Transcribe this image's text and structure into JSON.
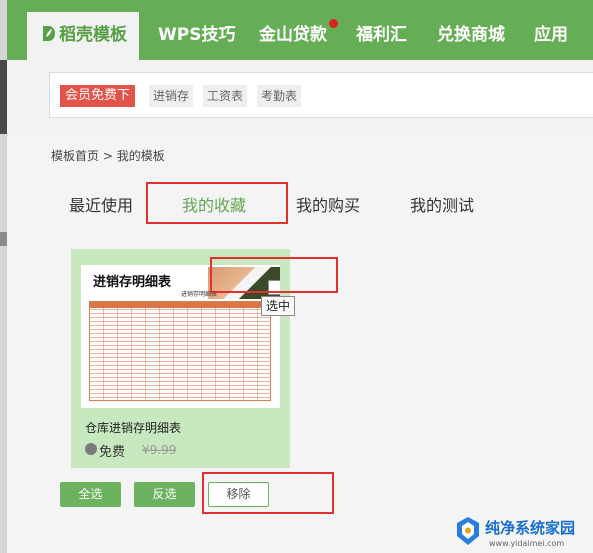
{
  "nav": {
    "tabs": [
      {
        "label": "稻壳模板"
      },
      {
        "label": "WPS技巧"
      },
      {
        "label": "金山贷款"
      },
      {
        "label": "福利汇"
      },
      {
        "label": "兑换商城"
      },
      {
        "label": "应用"
      }
    ],
    "brand_color": "#65ae55"
  },
  "tags": {
    "vip_label": "会员免费下",
    "items": [
      "进销存",
      "工资表",
      "考勤表"
    ]
  },
  "breadcrumb": {
    "home": "模板首页",
    "separator": ">",
    "current": "我的模板"
  },
  "subtabs": [
    {
      "label": "最近使用"
    },
    {
      "label": "我的收藏"
    },
    {
      "label": "我的购买"
    },
    {
      "label": "我的测试"
    }
  ],
  "card": {
    "thumb_title": "进销存明细表",
    "thumb_subtitle": "进销存明细表",
    "name": "仓库进销存明细表",
    "price_label": "免费",
    "original_price": "¥9.99",
    "tooltip": "选中"
  },
  "actions": {
    "select_all": "全选",
    "invert": "反选",
    "remove": "移除"
  },
  "watermark": {
    "title": "纯净系统家园",
    "url": "www.yidaimei.com"
  },
  "highlight_color": "#e03030"
}
